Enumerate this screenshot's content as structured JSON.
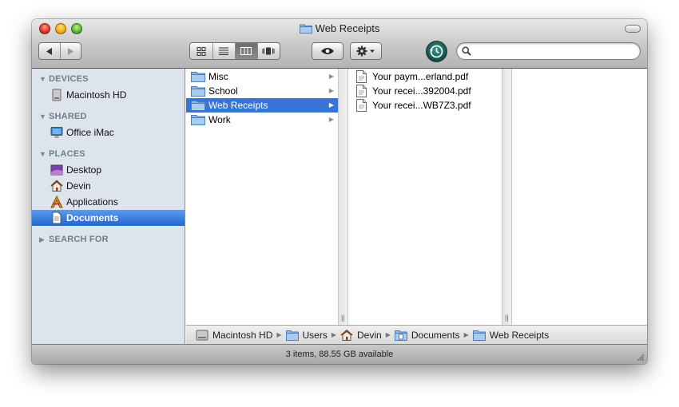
{
  "window": {
    "title": "Web Receipts"
  },
  "toolbar": {
    "back_icon": "back-arrow-icon",
    "forward_icon": "forward-arrow-icon",
    "view_modes": [
      "icon-view-icon",
      "list-view-icon",
      "column-view-icon",
      "coverflow-view-icon"
    ],
    "active_view": 2,
    "quick_look_icon": "eye-icon",
    "action_icon": "gear-icon",
    "time_machine_icon": "time-machine-icon",
    "search": {
      "value": "",
      "placeholder": ""
    }
  },
  "sidebar": {
    "sections": {
      "devices": "DEVICES",
      "shared": "SHARED",
      "places": "PLACES",
      "search_for": "SEARCH FOR"
    },
    "devices": [
      {
        "label": "Macintosh HD",
        "icon": "hard-drive-icon"
      }
    ],
    "shared": [
      {
        "label": "Office iMac",
        "icon": "imac-icon"
      }
    ],
    "places": [
      {
        "label": "Desktop",
        "icon": "desktop-icon"
      },
      {
        "label": "Devin",
        "icon": "home-icon"
      },
      {
        "label": "Applications",
        "icon": "applications-icon"
      },
      {
        "label": "Documents",
        "icon": "documents-icon",
        "selected": true
      }
    ]
  },
  "columns": {
    "folders": [
      {
        "label": "Misc"
      },
      {
        "label": "School"
      },
      {
        "label": "Web Receipts",
        "selected": true
      },
      {
        "label": "Work"
      }
    ],
    "files": [
      {
        "label": "Your paym...erland.pdf"
      },
      {
        "label": "Your recei...392004.pdf"
      },
      {
        "label": "Your recei...WB7Z3.pdf"
      }
    ]
  },
  "pathbar": [
    {
      "label": "Macintosh HD",
      "icon": "hard-drive-icon"
    },
    {
      "label": "Users",
      "icon": "folder-icon"
    },
    {
      "label": "Devin",
      "icon": "home-icon"
    },
    {
      "label": "Documents",
      "icon": "documents-folder-icon"
    },
    {
      "label": "Web Receipts",
      "icon": "folder-icon"
    }
  ],
  "status": {
    "text": "3 items, 88.55 GB available"
  },
  "colors": {
    "selection": "#3874d7",
    "sidebar_bg": "#dde4ec",
    "sidebar_selection": "#2267d0"
  }
}
